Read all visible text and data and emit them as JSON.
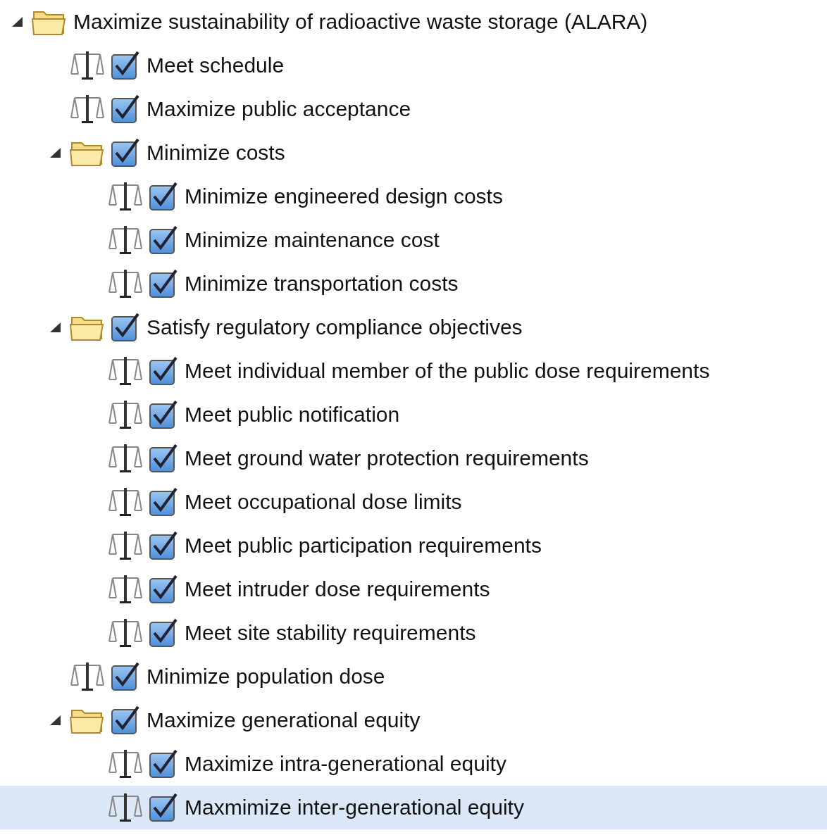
{
  "tree": [
    {
      "label": "Maximize sustainability of radioactive waste storage (ALARA)",
      "kind": "folder",
      "expanded": true,
      "selected": false,
      "children": [
        {
          "label": "Meet schedule",
          "kind": "criterion",
          "checked": true,
          "selected": false
        },
        {
          "label": "Maximize public acceptance",
          "kind": "criterion",
          "checked": true,
          "selected": false
        },
        {
          "label": "Minimize costs",
          "kind": "folder",
          "expanded": true,
          "checked": true,
          "selected": false,
          "children": [
            {
              "label": "Minimize engineered design costs",
              "kind": "criterion",
              "checked": true,
              "selected": false
            },
            {
              "label": "Minimize maintenance cost",
              "kind": "criterion",
              "checked": true,
              "selected": false
            },
            {
              "label": "Minimize transportation costs",
              "kind": "criterion",
              "checked": true,
              "selected": false
            }
          ]
        },
        {
          "label": "Satisfy regulatory compliance objectives",
          "kind": "folder",
          "expanded": true,
          "checked": true,
          "selected": false,
          "children": [
            {
              "label": "Meet individual member of the public dose requirements",
              "kind": "criterion",
              "checked": true,
              "selected": false
            },
            {
              "label": "Meet public notification",
              "kind": "criterion",
              "checked": true,
              "selected": false
            },
            {
              "label": "Meet ground water protection requirements",
              "kind": "criterion",
              "checked": true,
              "selected": false
            },
            {
              "label": "Meet occupational dose limits",
              "kind": "criterion",
              "checked": true,
              "selected": false
            },
            {
              "label": "Meet public participation requirements",
              "kind": "criterion",
              "checked": true,
              "selected": false
            },
            {
              "label": "Meet intruder dose requirements",
              "kind": "criterion",
              "checked": true,
              "selected": false
            },
            {
              "label": "Meet site stability requirements",
              "kind": "criterion",
              "checked": true,
              "selected": false
            }
          ]
        },
        {
          "label": "Minimize population dose",
          "kind": "criterion",
          "checked": true,
          "selected": false
        },
        {
          "label": "Maximize generational equity",
          "kind": "folder",
          "expanded": true,
          "checked": true,
          "selected": false,
          "children": [
            {
              "label": "Maximize intra-generational equity",
              "kind": "criterion",
              "checked": true,
              "selected": false
            },
            {
              "label": "Maxmimize inter-generational equity",
              "kind": "criterion",
              "checked": true,
              "selected": true
            }
          ]
        }
      ]
    }
  ]
}
